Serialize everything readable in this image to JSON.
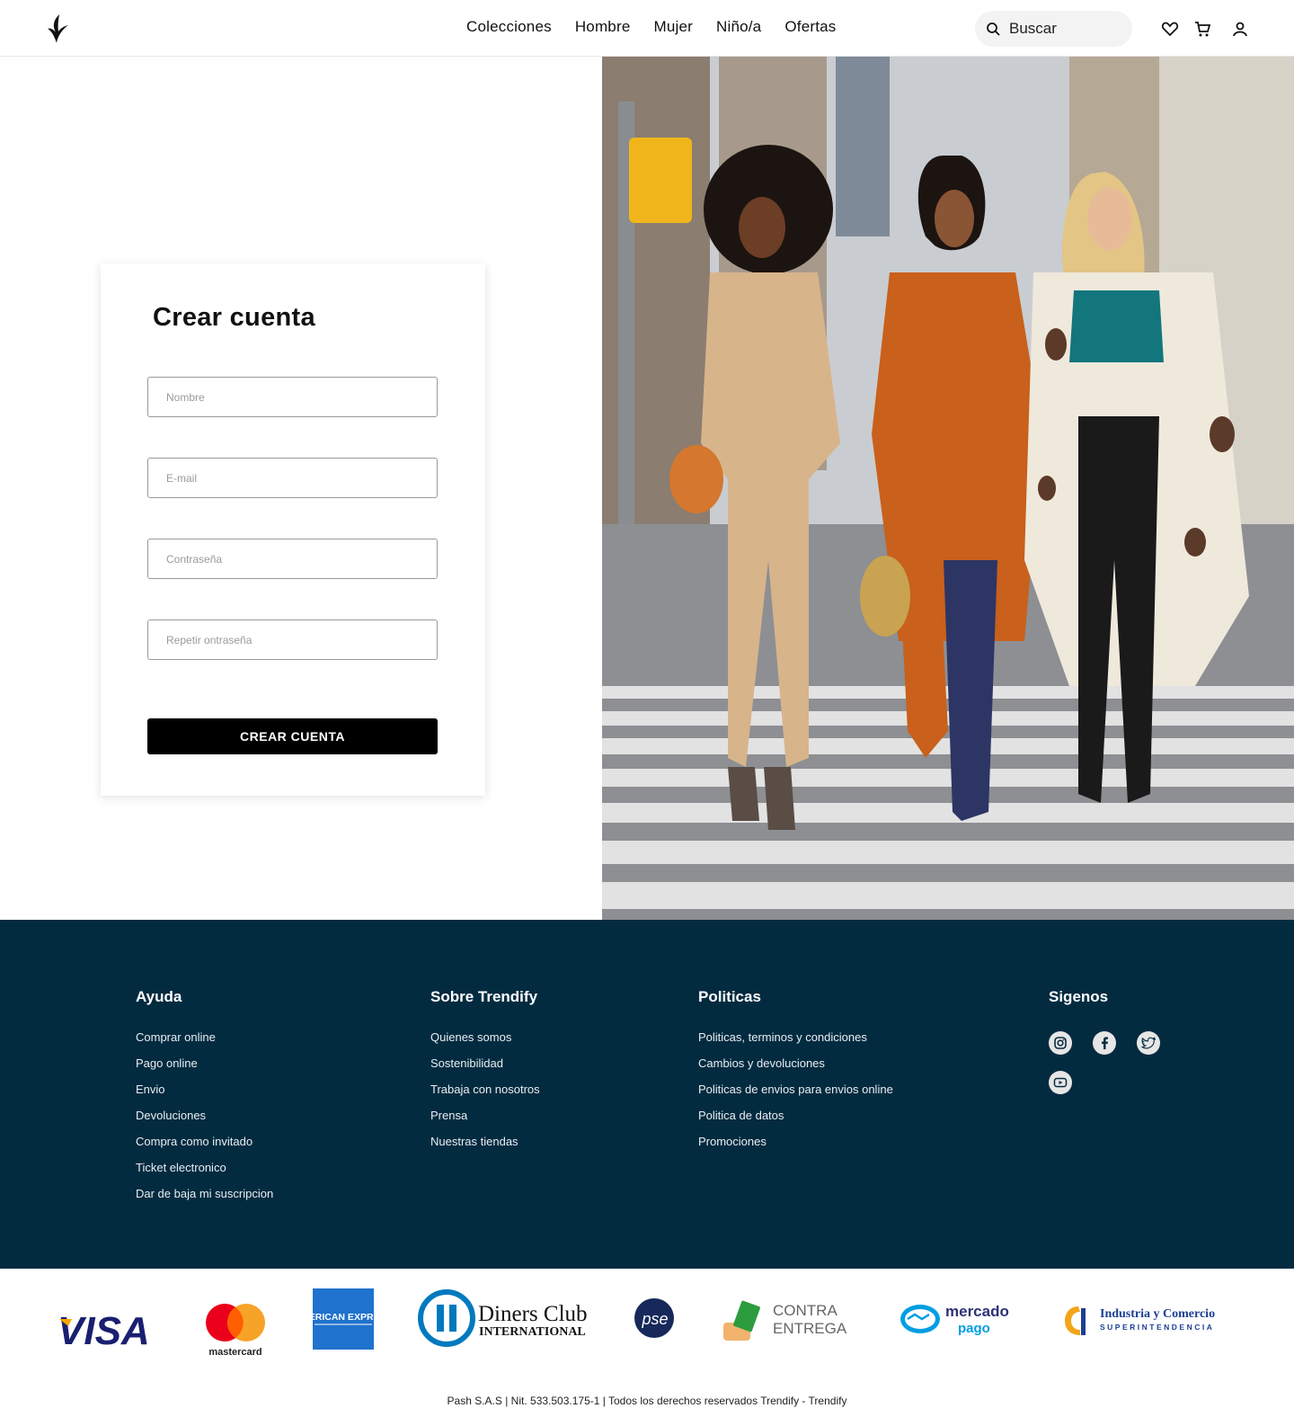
{
  "header": {
    "logo_icon": "brand-leaf-logo",
    "nav": [
      "Colecciones",
      "Hombre",
      "Mujer",
      "Niño/a",
      "Ofertas"
    ],
    "search_placeholder": "Buscar",
    "icons": [
      "heart-icon",
      "cart-icon",
      "user-icon"
    ]
  },
  "form": {
    "title": "Crear cuenta",
    "fields": [
      {
        "placeholder": "Nombre",
        "value": ""
      },
      {
        "placeholder": "E-mail",
        "value": ""
      },
      {
        "placeholder": "Contraseña",
        "value": ""
      },
      {
        "placeholder": "Repetir ontraseña",
        "value": ""
      }
    ],
    "submit_label": "CREAR CUENTA"
  },
  "hero": {
    "colors": {
      "sky": "#c9cdd1",
      "street": "#8d8f93",
      "stripe": "#e2e2e2",
      "beige": "#d8b48b",
      "orange": "#c9601b",
      "boot": "#2d3565",
      "teal": "#12767c"
    }
  },
  "footer": {
    "background": "#032b40",
    "columns": [
      {
        "title": "Ayuda",
        "links": [
          "Comprar online",
          "Pago online",
          "Envio",
          "Devoluciones",
          "Compra como invitado",
          "Ticket electronico",
          "Dar de baja mi suscripcion"
        ]
      },
      {
        "title": "Sobre Trendify",
        "links": [
          "Quienes somos",
          "Sostenibilidad",
          "Trabaja con nosotros",
          "Prensa",
          "Nuestras tiendas"
        ]
      },
      {
        "title": "Politicas",
        "links": [
          "Politicas, terminos y condiciones",
          "Cambios y devoluciones",
          "Politicas de envios para envios online",
          "Politica de datos",
          "Promociones"
        ]
      }
    ],
    "social": {
      "title": "Sigenos",
      "icons": [
        "instagram-icon",
        "facebook-icon",
        "twitter-icon",
        "youtube-icon"
      ]
    }
  },
  "payments": {
    "logos": [
      "VISA",
      "mastercard",
      "AMERICAN EXPRESS",
      "Diners Club",
      "INTERNATIONAL",
      "pse",
      "CONTRA",
      "ENTREGA",
      "mercado",
      "pago",
      "Industria y Comercio",
      "SUPERINTENDENCIA"
    ],
    "copyright": "Pash S.A.S | Nit. 533.503.175-1 | Todos los derechos reservados Trendify - Trendify"
  }
}
